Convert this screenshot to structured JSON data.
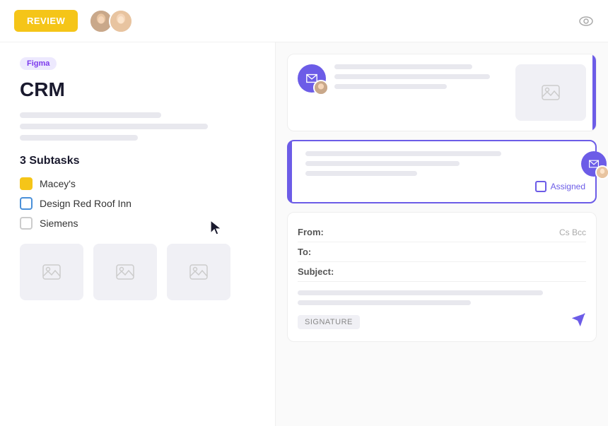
{
  "topbar": {
    "review_label": "REVIEW",
    "eye_icon": "eye-icon"
  },
  "left_panel": {
    "badge": "Figma",
    "title": "CRM",
    "subtasks_label": "3 Subtasks",
    "subtasks": [
      {
        "name": "Macey's",
        "checkbox_type": "yellow"
      },
      {
        "name": "Design Red Roof Inn",
        "checkbox_type": "blue"
      },
      {
        "name": "Siemens",
        "checkbox_type": "gray"
      }
    ]
  },
  "right_panel": {
    "email_card_1": {
      "lines": [
        {
          "width": "80%"
        },
        {
          "width": "65%"
        },
        {
          "width": "50%"
        }
      ]
    },
    "email_card_2": {
      "lines": [
        {
          "width": "70%"
        },
        {
          "width": "55%"
        },
        {
          "width": "40%"
        }
      ],
      "assigned_label": "Assigned"
    },
    "compose": {
      "from_label": "From:",
      "to_label": "To:",
      "subject_label": "Subject:",
      "cc_label": "Cs Bcc",
      "signature_label": "SIGNATURE"
    }
  },
  "cursor": {
    "visible": true
  }
}
